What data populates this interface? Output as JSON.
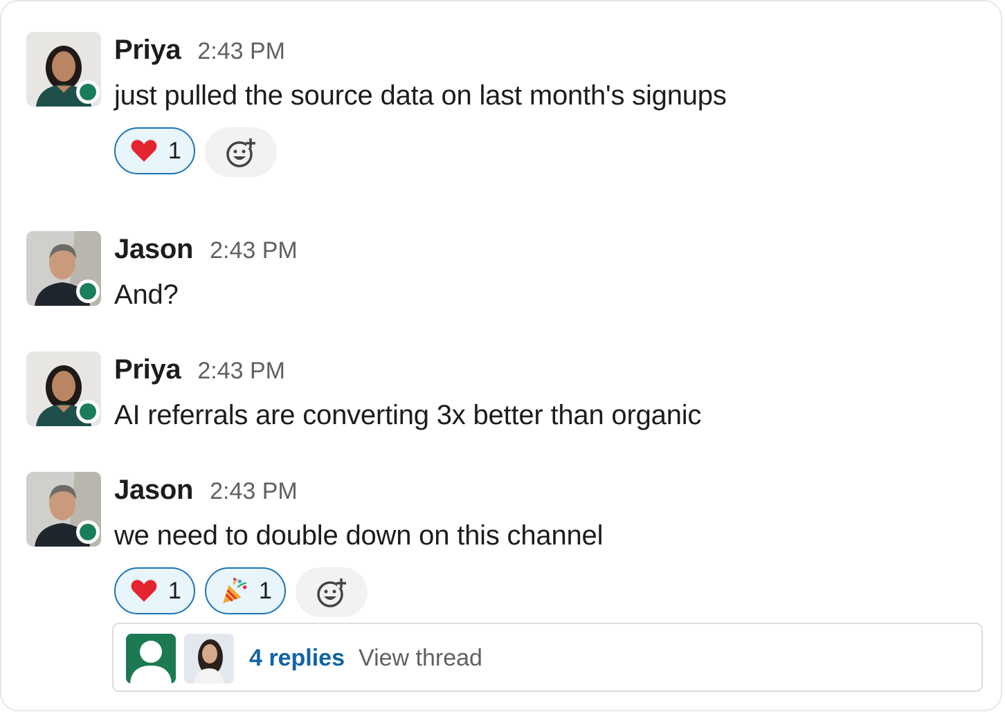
{
  "colors": {
    "presence_online": "#1b7e5a",
    "reaction_border": "#1d73b6",
    "reaction_bg": "#e8f5fa",
    "link": "#1264a3",
    "timestamp": "#616061"
  },
  "messages": [
    {
      "author": "Priya",
      "time": "2:43 PM",
      "text": "just pulled the source data on last month's signups",
      "reactions": [
        {
          "emoji": "heart-emoji",
          "count": "1"
        }
      ]
    },
    {
      "author": "Jason",
      "time": "2:43 PM",
      "text": "And?"
    },
    {
      "author": "Priya",
      "time": "2:43 PM",
      "text": "AI referrals are converting 3x better than organic"
    },
    {
      "author": "Jason",
      "time": "2:43 PM",
      "text": "we need to double down on this channel",
      "reactions": [
        {
          "emoji": "heart-emoji",
          "count": "1"
        },
        {
          "emoji": "party-popper-emoji",
          "count": "1"
        }
      ],
      "thread": {
        "replies_label": "4 replies",
        "view_label": "View thread"
      }
    }
  ]
}
